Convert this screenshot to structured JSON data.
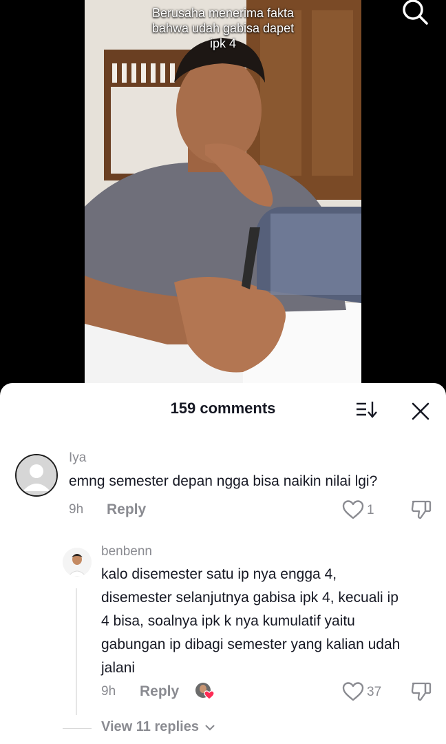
{
  "video": {
    "caption_lines": [
      "Berusaha menerima fakta",
      "bahwa udah gabisa dapet",
      "ipk 4"
    ]
  },
  "comments_panel": {
    "count_label": "159 comments"
  },
  "comments": [
    {
      "username": "Iya",
      "text": "emng semester depan ngga bisa naikin nilai lgi?",
      "time": "9h",
      "reply_label": "Reply",
      "likes": "1"
    },
    {
      "username": "benbenn",
      "text_lines": [
        "kalo disemester satu ip nya engga 4,",
        "disemester selanjutnya gabisa ipk 4, kecuali ip",
        "4 bisa, soalnya ipk k nya kumulatif yaitu",
        "gabungan ip dibagi semester yang kalian udah",
        "jalani"
      ],
      "time": "9h",
      "reply_label": "Reply",
      "likes": "37"
    }
  ],
  "view_replies_label": "View 11 replies",
  "icons": {
    "search": "search-icon",
    "sort": "sort-icon",
    "close": "close-icon",
    "like": "heart-outline-icon",
    "dislike": "thumbs-down-icon",
    "expand": "chevron-down-icon",
    "creator_liked": "creator-liked-heart-icon"
  },
  "colors": {
    "text_primary": "#161823",
    "text_secondary": "#8a8b91",
    "creator_heart": "#fe2c55"
  }
}
